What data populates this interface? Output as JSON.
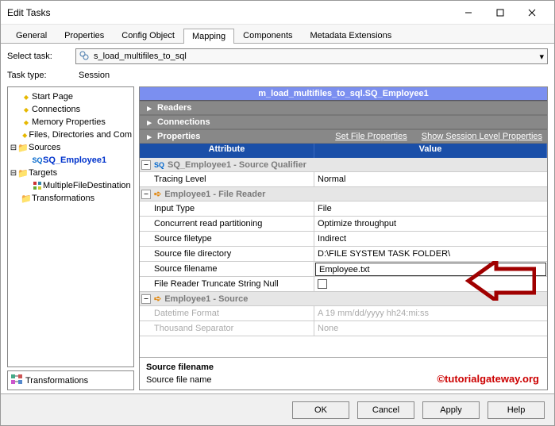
{
  "window_title": "Edit Tasks",
  "tabs": [
    "General",
    "Properties",
    "Config Object",
    "Mapping",
    "Components",
    "Metadata Extensions"
  ],
  "active_tab": 3,
  "select_task_label": "Select task:",
  "select_task_value": "s_load_multifiles_to_sql",
  "task_type_label": "Task type:",
  "task_type_value": "Session",
  "tree": {
    "start_page": "Start Page",
    "connections": "Connections",
    "memory": "Memory Properties",
    "files": "Files, Directories and Com",
    "sources": "Sources",
    "sq": "SQ_Employee1",
    "targets": "Targets",
    "mfd": "MultipleFileDestination",
    "transformations": "Transformations"
  },
  "left_tab": "Transformations",
  "header_title": "m_load_multifiles_to_sql.SQ_Employee1",
  "sections": {
    "readers": "Readers",
    "connections": "Connections",
    "properties": "Properties"
  },
  "links": {
    "setfile": "Set File Properties",
    "showsession": "Show Session Level Properties"
  },
  "gridcols": {
    "attr": "Attribute",
    "val": "Value"
  },
  "group1": "SQ_Employee1 - Source Qualifier",
  "row_tracing_attr": "Tracing Level",
  "row_tracing_val": "Normal",
  "group2": "Employee1 - File Reader",
  "row_input_attr": "Input Type",
  "row_input_val": "File",
  "row_crp_attr": "Concurrent read partitioning",
  "row_crp_val": "Optimize throughput",
  "row_ft_attr": "Source filetype",
  "row_ft_val": "Indirect",
  "row_dir_attr": "Source file directory",
  "row_dir_val": "D:\\FILE SYSTEM TASK FOLDER\\",
  "row_fn_attr": "Source filename",
  "row_fn_val": "Employee.txt",
  "row_trunc_attr": "File Reader Truncate String Null",
  "group3": "Employee1 - Source",
  "row_dt_attr": "Datetime Format",
  "row_dt_val": "A  19 mm/dd/yyyy hh24:mi:ss",
  "row_ts_attr": "Thousand Separator",
  "row_ts_val": "None",
  "desc_title": "Source filename",
  "desc_body": "Source file name",
  "watermark": "©tutorialgateway.org",
  "buttons": {
    "ok": "OK",
    "cancel": "Cancel",
    "apply": "Apply",
    "help": "Help"
  }
}
